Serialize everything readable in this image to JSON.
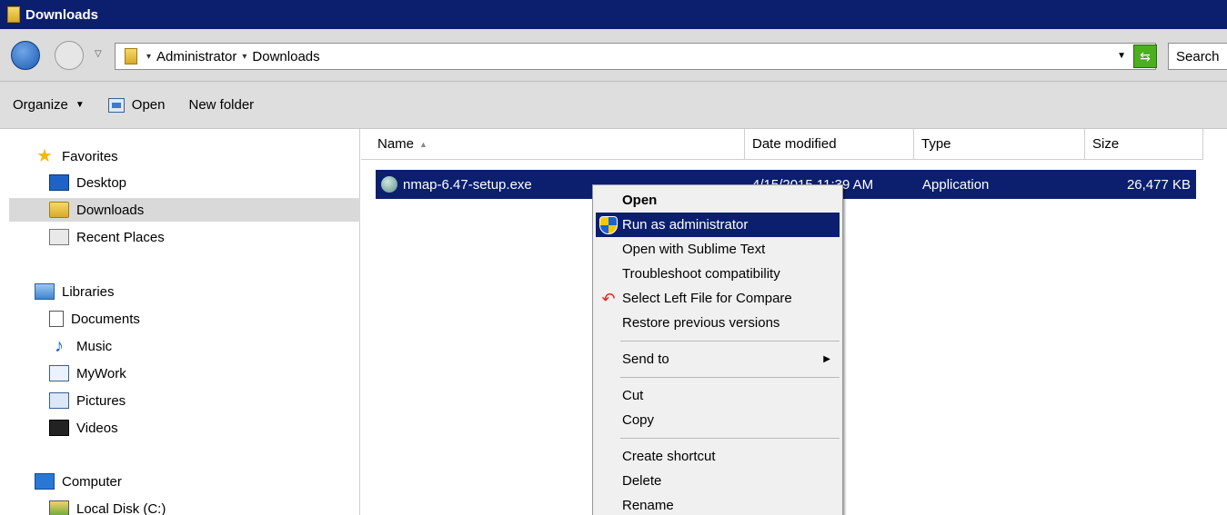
{
  "window": {
    "title": "Downloads"
  },
  "address": {
    "crumbs": [
      "Administrator",
      "Downloads"
    ],
    "search_placeholder": "Search"
  },
  "toolbar": {
    "organize_label": "Organize",
    "open_label": "Open",
    "new_folder_label": "New folder"
  },
  "nav": {
    "favorites": {
      "label": "Favorites",
      "items": [
        "Desktop",
        "Downloads",
        "Recent Places"
      ]
    },
    "libraries": {
      "label": "Libraries",
      "items": [
        "Documents",
        "Music",
        "MyWork",
        "Pictures",
        "Videos"
      ]
    },
    "computer": {
      "label": "Computer",
      "items": [
        "Local Disk (C:)"
      ]
    },
    "selected_item": "Downloads"
  },
  "columns": {
    "name": "Name",
    "date": "Date modified",
    "type": "Type",
    "size": "Size"
  },
  "files": [
    {
      "name": "nmap-6.47-setup.exe",
      "date": "4/15/2015 11:39 AM",
      "type": "Application",
      "size": "26,477 KB",
      "selected": true
    }
  ],
  "context_menu": {
    "items": [
      "Open",
      "Run as administrator",
      "Open with Sublime Text",
      "Troubleshoot compatibility",
      "Select Left File for Compare",
      "Restore previous versions",
      "Send to",
      "Cut",
      "Copy",
      "Create shortcut",
      "Delete",
      "Rename"
    ],
    "highlighted": "Run as administrator"
  },
  "colors": {
    "selection": "#0b1f6e",
    "titlebar": "#0b1f6e"
  }
}
